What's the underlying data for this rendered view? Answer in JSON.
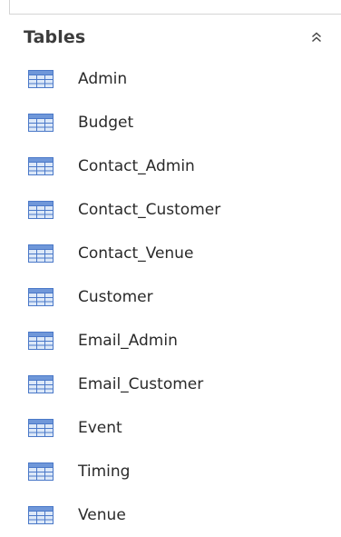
{
  "panel": {
    "group_title": "Tables",
    "collapse_icon": "chevron-double-up-icon",
    "item_icon": "table-icon",
    "colors": {
      "icon_blue": "#4a78c8",
      "icon_fill": "#dce8f8",
      "icon_header": "#6f97d9",
      "text": "#2a2a2a",
      "header_text": "#3c3c3c"
    },
    "items": [
      {
        "label": "Admin"
      },
      {
        "label": "Budget"
      },
      {
        "label": "Contact_Admin"
      },
      {
        "label": "Contact_Customer"
      },
      {
        "label": "Contact_Venue"
      },
      {
        "label": "Customer"
      },
      {
        "label": "Email_Admin"
      },
      {
        "label": "Email_Customer"
      },
      {
        "label": "Event"
      },
      {
        "label": "Timing"
      },
      {
        "label": "Venue"
      }
    ]
  }
}
